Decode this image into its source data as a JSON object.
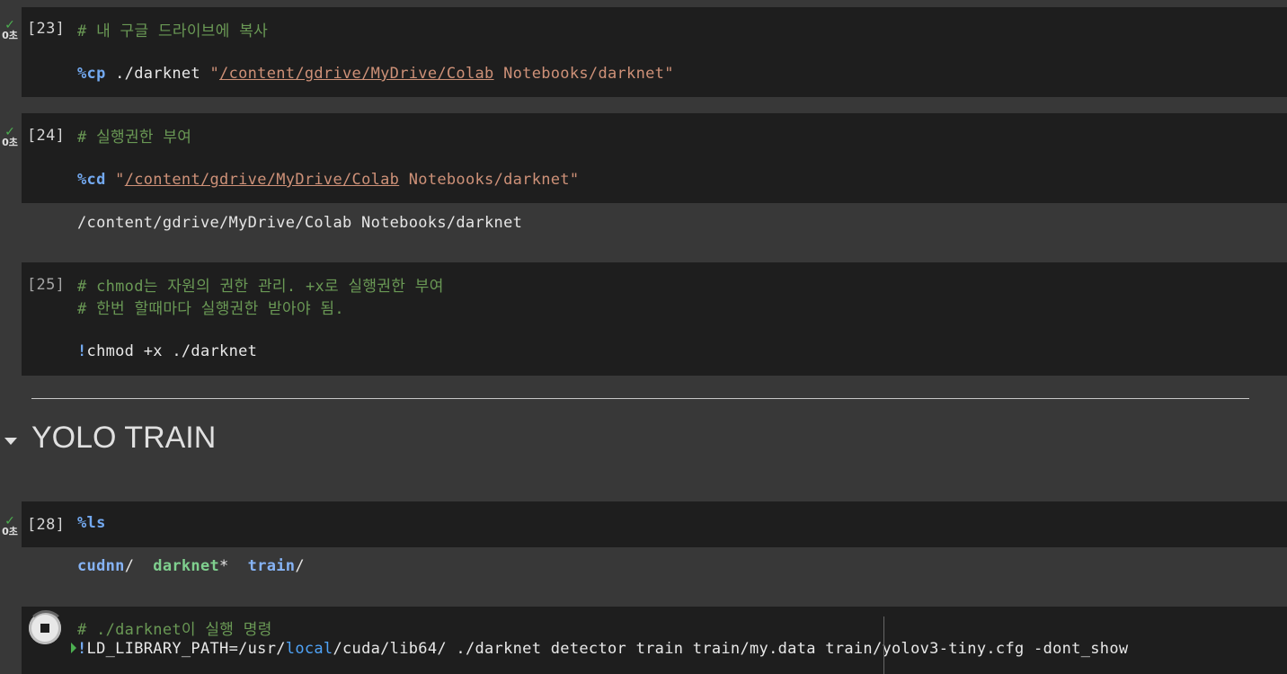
{
  "cells": [
    {
      "prompt": "[23]",
      "status_icon": "check-icon",
      "exec_time": "0초",
      "comment": "# 내 구글 드라이브에 복사",
      "magic": "%cp",
      "arg": " ./darknet ",
      "str_open": "\"",
      "str_link": "/content/gdrive/MyDrive/Colab",
      "str_rest": " Notebooks/darknet\""
    },
    {
      "prompt": "[24]",
      "status_icon": "check-icon",
      "exec_time": "0초",
      "comment": "# 실행권한 부여",
      "magic": "%cd",
      "arg": " ",
      "str_open": "\"",
      "str_link": "/content/gdrive/MyDrive/Colab",
      "str_rest": " Notebooks/darknet\"",
      "output": "/content/gdrive/MyDrive/Colab Notebooks/darknet"
    },
    {
      "prompt": "[25]",
      "comment1": "# chmod는 자원의 권한 관리. +x로 실행권한 부여",
      "comment2": "# 한번 할때마다 실행권한 받아야 됨.",
      "bang": "!",
      "cmd": "chmod +x ./darknet"
    }
  ],
  "section": {
    "title": "YOLO TRAIN",
    "collapse_icon": "caret-down-icon"
  },
  "ls_cell": {
    "prompt": "[28]",
    "status_icon": "check-icon",
    "exec_time": "0초",
    "magic": "%ls",
    "output": [
      {
        "name": "cudnn",
        "suffix": "/  "
      },
      {
        "name": "darknet",
        "suffix": "*  "
      },
      {
        "name": "train",
        "suffix": "/"
      }
    ]
  },
  "running_cell": {
    "stop_icon": "stop-icon",
    "comment": "# ./darknet이 실행 명령",
    "bang": "!",
    "cmd_a": "LD_LIBRARY_PATH=/usr/",
    "cmd_local": "local",
    "cmd_b": "/cuda/lib64/ ./darknet detector train train/my.data train/yolov3-tiny.cfg -dont_show"
  },
  "colors": {
    "comment": "#6a9955",
    "magic": "#73a9f0",
    "string": "#ce9178",
    "cell_bg": "#1e1e1e",
    "page_bg": "#383838",
    "success": "#4caf50"
  }
}
